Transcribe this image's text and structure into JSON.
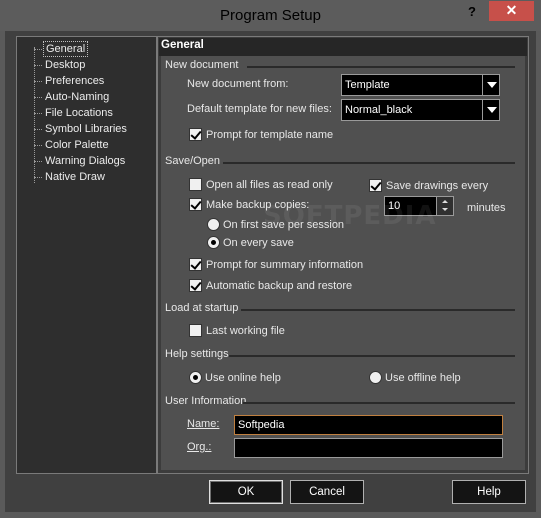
{
  "window": {
    "title": "Program Setup",
    "help_glyph": "?",
    "close_glyph": "✕"
  },
  "tree": {
    "items": [
      {
        "label": "General",
        "selected": true
      },
      {
        "label": "Desktop"
      },
      {
        "label": "Preferences"
      },
      {
        "label": "Auto-Naming"
      },
      {
        "label": "File Locations"
      },
      {
        "label": "Symbol Libraries"
      },
      {
        "label": "Color Palette"
      },
      {
        "label": "Warning Dialogs"
      },
      {
        "label": "Native Draw"
      }
    ]
  },
  "panel": {
    "title": "General",
    "new_document": {
      "heading": "New document",
      "from_label": "New document from:",
      "from_value": "Template",
      "template_label": "Default template for new files:",
      "template_value": "Normal_black",
      "prompt_label": "Prompt for template name",
      "prompt_checked": true
    },
    "save_open": {
      "heading": "Save/Open",
      "open_readonly_label": "Open all files as read only",
      "open_readonly_checked": false,
      "save_drawings_label": "Save drawings every",
      "save_drawings_checked": true,
      "save_minutes_value": "10",
      "minutes_label": "minutes",
      "backup_label": "Make backup copies:",
      "backup_checked": true,
      "first_save_label": "On first save per session",
      "every_save_label": "On every save",
      "backup_mode": "every_save",
      "summary_label": "Prompt for summary information",
      "summary_checked": true,
      "auto_backup_label": "Automatic backup and restore",
      "auto_backup_checked": true
    },
    "load_startup": {
      "heading": "Load at startup",
      "last_file_label": "Last working file",
      "last_file_checked": false
    },
    "help_settings": {
      "heading": "Help settings",
      "online_label": "Use online help",
      "offline_label": "Use offline help",
      "selected": "online"
    },
    "user_info": {
      "heading": "User Information",
      "name_label": "Name:",
      "name_value": "Softpedia",
      "org_label": "Org.:",
      "org_value": ""
    }
  },
  "watermark": "SOFTPEDIA",
  "buttons": {
    "ok": "OK",
    "cancel": "Cancel",
    "help": "Help"
  }
}
